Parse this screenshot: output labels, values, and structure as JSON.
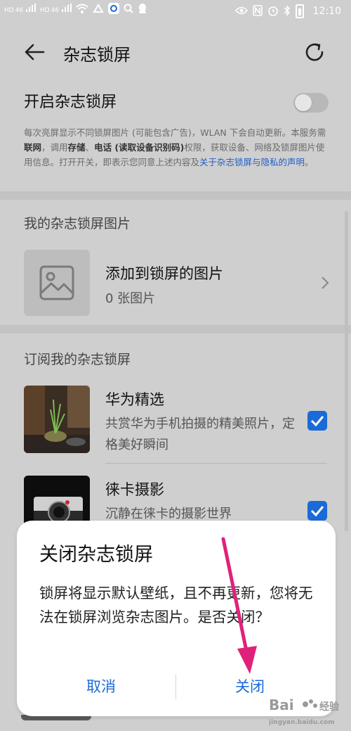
{
  "status_bar": {
    "left_labels": [
      "HD",
      "46",
      "HD",
      "46"
    ],
    "time": "12:10"
  },
  "header": {
    "title": "杂志锁屏"
  },
  "toggle_row": {
    "label": "开启杂志锁屏",
    "enabled": false
  },
  "description": {
    "t1": "每次亮屏显示不同锁屏图片 (可能包含广告)，WLAN 下会自动更新。本服务需",
    "b1": "联网",
    "t2": "，调用",
    "b2": "存储",
    "t3": "、",
    "b3": "电话 (读取设备识别码)",
    "t4": "权限，获取设备、网络及锁屏图片使用信息。打开开关，即表示您同意上述内容及",
    "link": "关于杂志锁屏与隐私的声明",
    "t5": "。"
  },
  "my_pictures": {
    "section_title": "我的杂志锁屏图片",
    "item_title": "添加到锁屏的图片",
    "item_sub": "0 张图片"
  },
  "subscriptions": {
    "section_title": "订阅我的杂志锁屏",
    "items": [
      {
        "title": "华为精选",
        "desc": "共赏华为手机拍摄的精美照片，定格美好瞬间",
        "checked": true
      },
      {
        "title": "徕卡摄影",
        "desc": "沉静在徕卡的摄影世界",
        "checked": true
      }
    ]
  },
  "dialog": {
    "title": "关闭杂志锁屏",
    "body": "锁屏将显示默认壁纸，且不再更新，您将无法在锁屏浏览杂志图片。是否关闭？",
    "cancel": "取消",
    "close": "关闭"
  },
  "colors": {
    "accent": "#1a6ad7",
    "annotation": "#e0217a"
  }
}
